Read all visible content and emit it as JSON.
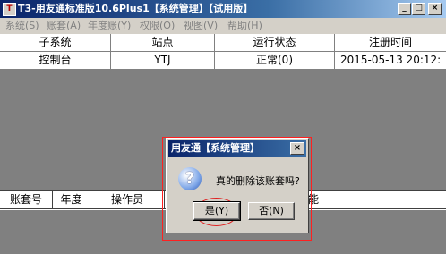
{
  "window": {
    "title": "T3-用友通标准版10.6Plus1【系统管理】【试用版】",
    "app_icon": "T",
    "min_icon": "_",
    "max_icon": "□",
    "close_icon": "×"
  },
  "menu": [
    {
      "label": "系统(S)"
    },
    {
      "label": "账套(A)"
    },
    {
      "label": "年度账(Y)"
    },
    {
      "label": "权限(O)"
    },
    {
      "label": "视图(V)"
    },
    {
      "label": "帮助(H)"
    }
  ],
  "top_table": {
    "headers": [
      "子系统",
      "站点",
      "运行状态",
      "注册时间"
    ],
    "rows": [
      [
        "控制台",
        "YTJ",
        "正常(0)",
        "2015-05-13 20:12:"
      ]
    ]
  },
  "bottom_table": {
    "headers": [
      "账套号",
      "年度",
      "操作员",
      "",
      "能"
    ]
  },
  "dialog": {
    "title": "用友通【系统管理】",
    "icon": "?",
    "close_icon": "×",
    "message": "真的删除该账套吗?",
    "yes_label": "是(Y)",
    "no_label": "否(N)"
  },
  "colors": {
    "title_bar": "#0a246a",
    "highlight_ring": "#e02020"
  }
}
